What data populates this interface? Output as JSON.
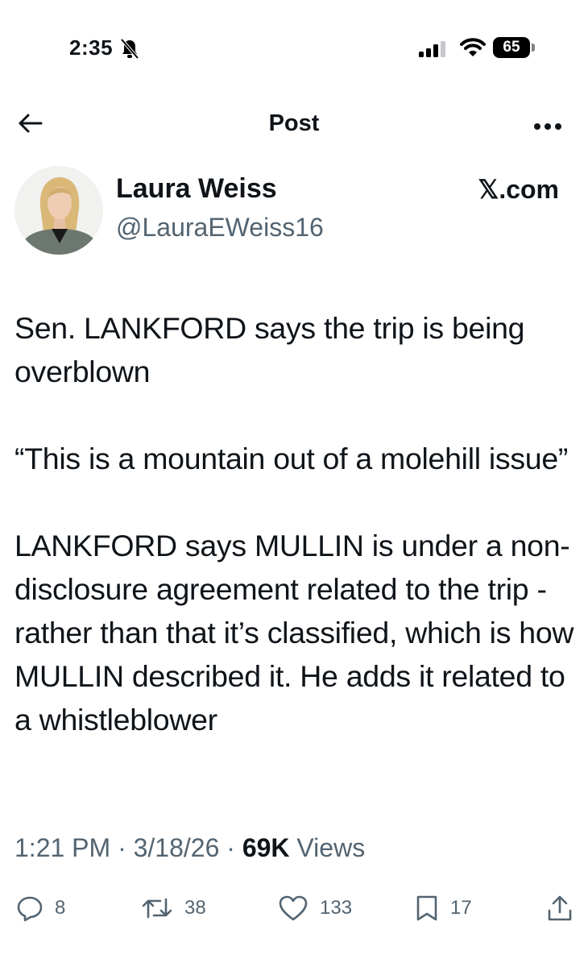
{
  "status_bar": {
    "time": "2:35",
    "battery": "65"
  },
  "header": {
    "title": "Post"
  },
  "author": {
    "name": "Laura Weiss",
    "handle": "@LauraEWeiss16"
  },
  "source_label": "𝕏.com",
  "post": {
    "paragraphs": [
      "Sen. LANKFORD says the trip is being overblown",
      "“This is a mountain out of a molehill issue”",
      "LANKFORD says MULLIN is under a non-disclosure agreement related to the trip - rather than that it’s classified, which is how MULLIN described it. He adds it related to a whistleblower"
    ]
  },
  "meta": {
    "time": "1:21 PM",
    "date": "3/18/26",
    "views_count": "69K",
    "views_label": "Views"
  },
  "actions": {
    "replies": "8",
    "reposts": "38",
    "likes": "133",
    "bookmarks": "17"
  },
  "icons": [
    "bell-slash-icon",
    "signal-icon",
    "wifi-icon",
    "back-arrow-icon",
    "more-icon",
    "reply-icon",
    "repost-icon",
    "like-icon",
    "bookmark-icon",
    "share-icon"
  ]
}
